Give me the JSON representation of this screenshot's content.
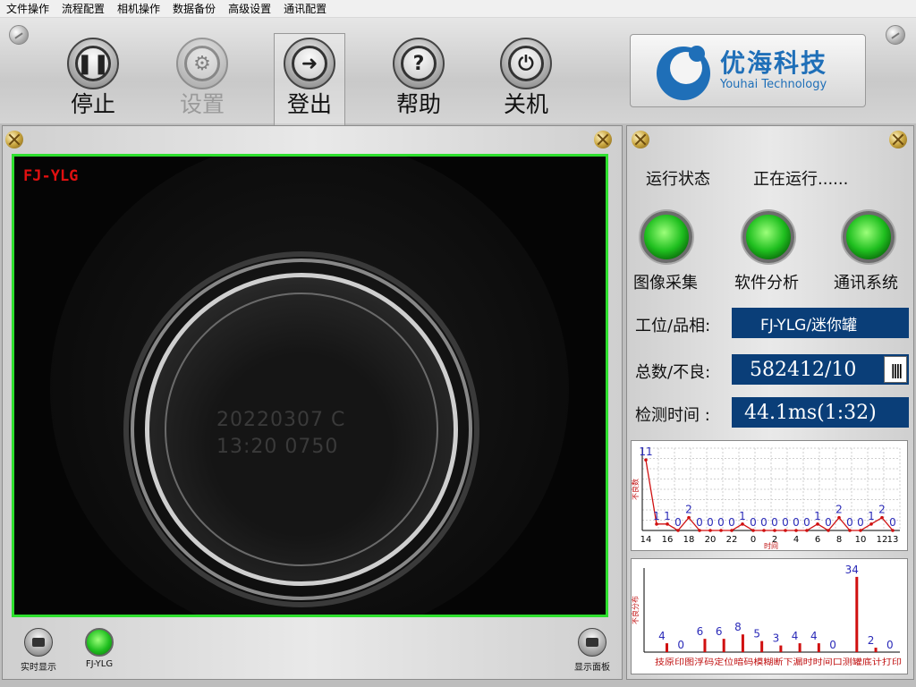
{
  "menu": [
    "文件操作",
    "流程配置",
    "相机操作",
    "数据备份",
    "高级设置",
    "通讯配置"
  ],
  "toolbar": {
    "stop_label": "停止",
    "settings_label": "设置",
    "logout_label": "登出",
    "help_label": "帮助",
    "shutdown_label": "关机"
  },
  "logo": {
    "cn": "优海科技",
    "en": "Youhai Technology"
  },
  "viewport": {
    "label": "FJ-YLG",
    "stamp_line1": "20220307 C",
    "stamp_line2": "13:20  0750"
  },
  "status": {
    "run_label": "运行状态",
    "run_value": "正在运行......",
    "indicators": [
      "图像采集",
      "软件分析",
      "通讯系统"
    ]
  },
  "fields": {
    "station_label": "工位/品相:",
    "station_value": "FJ-YLG/迷你罐",
    "total_label": "总数/不良:",
    "total_value": "582412/10",
    "time_label": "检测时间 :",
    "time_value": "44.1ms(1:32)"
  },
  "chart_data": [
    {
      "type": "line",
      "ylabel": "不良数",
      "xlabel": "时间",
      "x": [
        "14",
        "15",
        "16",
        "17",
        "18",
        "19",
        "20",
        "21",
        "22",
        "23",
        "0",
        "1",
        "2",
        "3",
        "4",
        "5",
        "6",
        "7",
        "8",
        "9",
        "10",
        "11",
        "12",
        "13"
      ],
      "tick_labels": [
        "14",
        "16",
        "18",
        "20",
        "22",
        "0",
        "2",
        "4",
        "6",
        "8",
        "10",
        "12",
        "13"
      ],
      "values": [
        11,
        1,
        1,
        0,
        2,
        0,
        0,
        0,
        0,
        1,
        0,
        0,
        0,
        0,
        0,
        0,
        1,
        0,
        2,
        0,
        0,
        1,
        2,
        0
      ]
    },
    {
      "type": "bar",
      "ylabel": "不良分布",
      "categories": [
        "技原",
        "印图",
        "浮码",
        "定位",
        "暗码",
        "模糊",
        "断下",
        "漏时",
        "时间",
        "口测",
        "罐底",
        "计打",
        "印"
      ],
      "category_strip": "技原印图浮码定位暗码模糊断下漏时时间口测罐底计打印",
      "values": [
        4,
        0,
        6,
        6,
        8,
        5,
        3,
        4,
        4,
        0,
        34,
        2,
        0
      ]
    }
  ],
  "bottom": {
    "realtime_label": "实时显示",
    "cam_label": "FJ-YLG",
    "panel_label": "显示面板"
  }
}
